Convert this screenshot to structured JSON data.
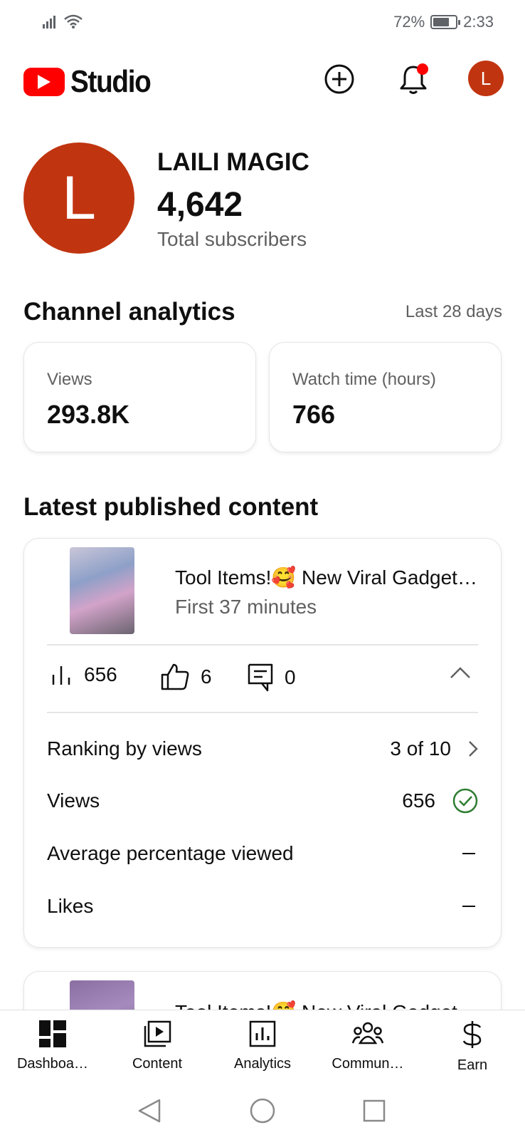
{
  "status_bar": {
    "battery_percent": "72%",
    "battery_level": 0.72,
    "time": "2:33"
  },
  "header": {
    "app_name": "Studio",
    "avatar_initial": "L"
  },
  "channel": {
    "avatar_initial": "L",
    "name": "LAILI MAGIC",
    "subscribers": "4,642",
    "subscribers_label": "Total subscribers"
  },
  "analytics": {
    "title": "Channel analytics",
    "period": "Last 28 days",
    "cards": [
      {
        "label": "Views",
        "value": "293.8K"
      },
      {
        "label": "Watch time (hours)",
        "value": "766"
      }
    ]
  },
  "latest": {
    "title": "Latest published content",
    "video": {
      "title": "Tool Items!🥰 New Viral Gadget…",
      "subtitle": "First 37 minutes",
      "views": "656",
      "likes": "6",
      "comments": "0"
    },
    "rows": [
      {
        "label": "Ranking by views",
        "value": "3 of 10"
      },
      {
        "label": "Views",
        "value": "656"
      },
      {
        "label": "Average percentage viewed",
        "value": ""
      },
      {
        "label": "Likes",
        "value": ""
      }
    ],
    "next_video_title": "Tool Items!🥰 New Viral Gadget…"
  },
  "bottom_nav": [
    {
      "label": "Dashboa…",
      "icon": "dashboard-icon"
    },
    {
      "label": "Content",
      "icon": "content-icon"
    },
    {
      "label": "Analytics",
      "icon": "analytics-icon"
    },
    {
      "label": "Commun…",
      "icon": "community-icon"
    },
    {
      "label": "Earn",
      "icon": "earn-icon"
    }
  ],
  "colors": {
    "brand_red": "#ff0000",
    "avatar": "#c03510",
    "success_green": "#2e7d32",
    "notification_dot": "#ff0000"
  }
}
